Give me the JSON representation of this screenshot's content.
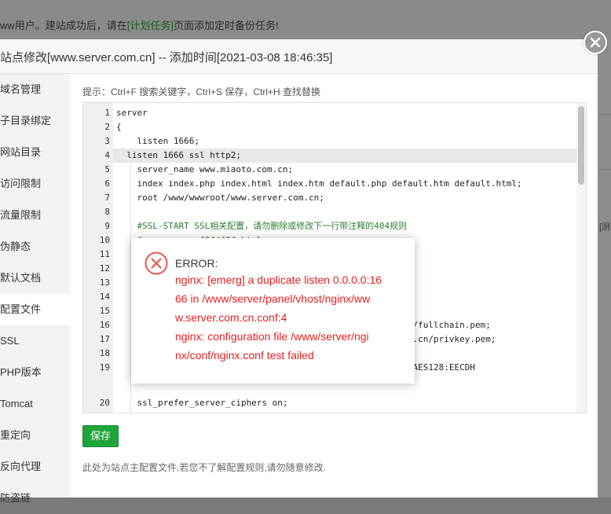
{
  "background": {
    "note_prefix": "ww用户。建站成功后，请在",
    "note_link": "[计划任务]",
    "note_suffix": "页面添加定时备份任务!",
    "right_edge_text": "[测"
  },
  "dialog": {
    "title": "站点修改[www.server.com.cn] -- 添加时间[2021-03-08 18:46:35]",
    "close_icon": "close-icon",
    "sidebar": [
      {
        "label": "域名管理"
      },
      {
        "label": "子目录绑定"
      },
      {
        "label": "网站目录"
      },
      {
        "label": "访问限制"
      },
      {
        "label": "流量限制"
      },
      {
        "label": "伪静态"
      },
      {
        "label": "默认文档"
      },
      {
        "label": "配置文件",
        "active": true
      },
      {
        "label": "SSL"
      },
      {
        "label": "PHP版本"
      },
      {
        "label": "Tomcat"
      },
      {
        "label": "重定向"
      },
      {
        "label": "反向代理"
      },
      {
        "label": "防盗链"
      }
    ],
    "hint": "提示：Ctrl+F 搜索关键字，Ctrl+S 保存，Ctrl+H 查找替换",
    "save_label": "保存",
    "footnote": "此处为站点主配置文件,若您不了解配置规则,请勿随意修改."
  },
  "editor": {
    "lines": [
      {
        "n": "1",
        "text": "server"
      },
      {
        "n": "2",
        "text": "{"
      },
      {
        "n": "3",
        "text": "    listen 1666;"
      },
      {
        "n": "4",
        "text": "  listen 1666 ssl http2;"
      },
      {
        "n": "5",
        "text": "    server_name www.miaoto.com.cn;"
      },
      {
        "n": "6",
        "text": "    index index.php index.html index.htm default.php default.htm default.html;"
      },
      {
        "n": "7",
        "text": "    root /www/wwwroot/www.server.com.cn;"
      },
      {
        "n": "8",
        "text": ""
      },
      {
        "n": "9",
        "text": "    #SSL-START SSL相关配置，请勿删除或修改下一行带注释的404规则"
      },
      {
        "n": "10",
        "text": "    #error_page 404/404.html;"
      },
      {
        "n": "11",
        "text": ""
      },
      {
        "n": "12",
        "text": ""
      },
      {
        "n": "13",
        "text": ""
      },
      {
        "n": "14",
        "text": ""
      },
      {
        "n": "15",
        "text": ""
      },
      {
        "n": "16",
        "text": "                                             erver.com.cn/fullchain.pem;"
      },
      {
        "n": "17",
        "text": "                                             w.server.com.cn/privkey.pem;"
      },
      {
        "n": "18",
        "text": ""
      },
      {
        "n": "19",
        "text": "                                             -AES128:RSA+AES128:EECDH"
      },
      {
        "n": "",
        "text": ""
      },
      {
        "n": "20",
        "text": "    ssl_prefer_server_ciphers on;"
      },
      {
        "n": "21",
        "text": "    ssl_session_cache shared:SSL:10m;"
      }
    ]
  },
  "error": {
    "title": "ERROR:",
    "lines": [
      "nginx: [emerg] a duplicate listen 0.0.0.0:16",
      "66 in /www/server/panel/vhost/nginx/ww",
      "w.server.com.cn.conf:4",
      "nginx: configuration file /www/server/ngi",
      "nx/conf/nginx.conf test failed"
    ]
  },
  "colors": {
    "accent_green": "#20a53a",
    "error_red": "#e82020"
  }
}
